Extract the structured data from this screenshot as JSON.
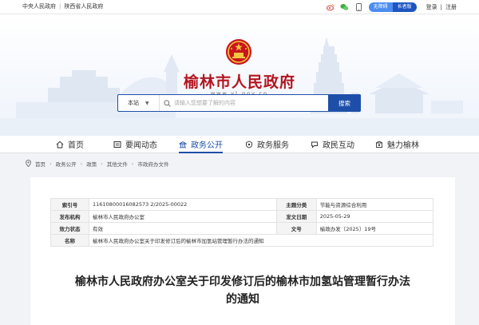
{
  "topbar": {
    "link1": "中央人民政府",
    "link2": "陕西省人民政府",
    "separator": "|",
    "elder_mode": "无障碍",
    "care_mode": "长者版",
    "login": "登录",
    "divider": "|",
    "register": "注册"
  },
  "banner": {
    "site_title": "榆林市人民政府",
    "site_url": "www.yl.gov.cn"
  },
  "search": {
    "scope": "本站",
    "placeholder": "请输入您想要了解的内容",
    "button": "搜索"
  },
  "nav": {
    "items": [
      {
        "label": "首页"
      },
      {
        "label": "要闻动态"
      },
      {
        "label": "政务公开"
      },
      {
        "label": "政务服务"
      },
      {
        "label": "政民互动"
      },
      {
        "label": "魅力榆林"
      }
    ]
  },
  "breadcrumb": {
    "items": [
      "首页",
      "政务公开",
      "政策",
      "其他文件",
      "市政府办文件"
    ],
    "arrow": "›"
  },
  "meta": {
    "index_no_label": "索引号",
    "index_no": "11610800016082573 2/2025-00022",
    "topic_label": "主题分类",
    "topic": "节能与资源综合利用",
    "issuer_label": "发布机构",
    "issuer": "榆林市人民政府办公室",
    "date_label": "发文日期",
    "date": "2025-05-29",
    "status_label": "效力状态",
    "status": "有效",
    "docno_label": "文号",
    "docno": "榆政办发〔2025〕19号",
    "name_label": "名称",
    "name": "榆林市人民政府办公室关于印发修订后的榆林市加氢站管理暂行办法的通知"
  },
  "doc_title": {
    "line1": "榆林市人民政府办公室关于印发修订后的榆林市加氢站管理暂行办法",
    "line2": "的通知"
  },
  "colors": {
    "brand_red": "#b3151f",
    "brand_blue": "#1d4fa8"
  }
}
